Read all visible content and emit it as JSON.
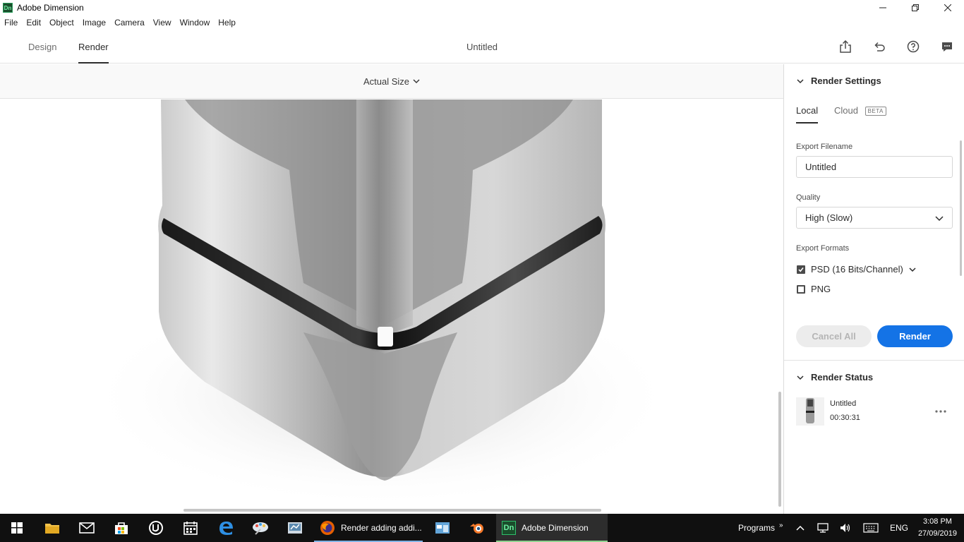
{
  "window": {
    "title": "Adobe Dimension",
    "logo_text": "Dn"
  },
  "menu": [
    "File",
    "Edit",
    "Object",
    "Image",
    "Camera",
    "View",
    "Window",
    "Help"
  ],
  "header": {
    "tabs": [
      "Design",
      "Render"
    ],
    "active_tab": "Render",
    "document_title": "Untitled"
  },
  "canvas": {
    "zoom": "Actual Size"
  },
  "render_settings": {
    "title": "Render Settings",
    "tabs": {
      "local": "Local",
      "cloud": "Cloud",
      "beta": "BETA"
    },
    "export_filename_label": "Export Filename",
    "export_filename_value": "Untitled",
    "quality_label": "Quality",
    "quality_value": "High (Slow)",
    "export_formats_label": "Export Formats",
    "formats": [
      {
        "label": "PSD (16 Bits/Channel)",
        "checked": true
      },
      {
        "label": "PNG",
        "checked": false
      }
    ],
    "cancel_label": "Cancel All",
    "render_label": "Render"
  },
  "render_status": {
    "title": "Render Status",
    "item_name": "Untitled",
    "item_time": "00:30:31"
  },
  "taskbar": {
    "apps": [
      {
        "label": "Render adding addi..."
      },
      {
        "label": "Adobe Dimension"
      }
    ],
    "programs_label": "Programs",
    "language": "ENG",
    "time": "3:08 PM",
    "date": "27/09/2019"
  },
  "colors": {
    "accent": "#1473e6",
    "taskbar": "#101010"
  }
}
